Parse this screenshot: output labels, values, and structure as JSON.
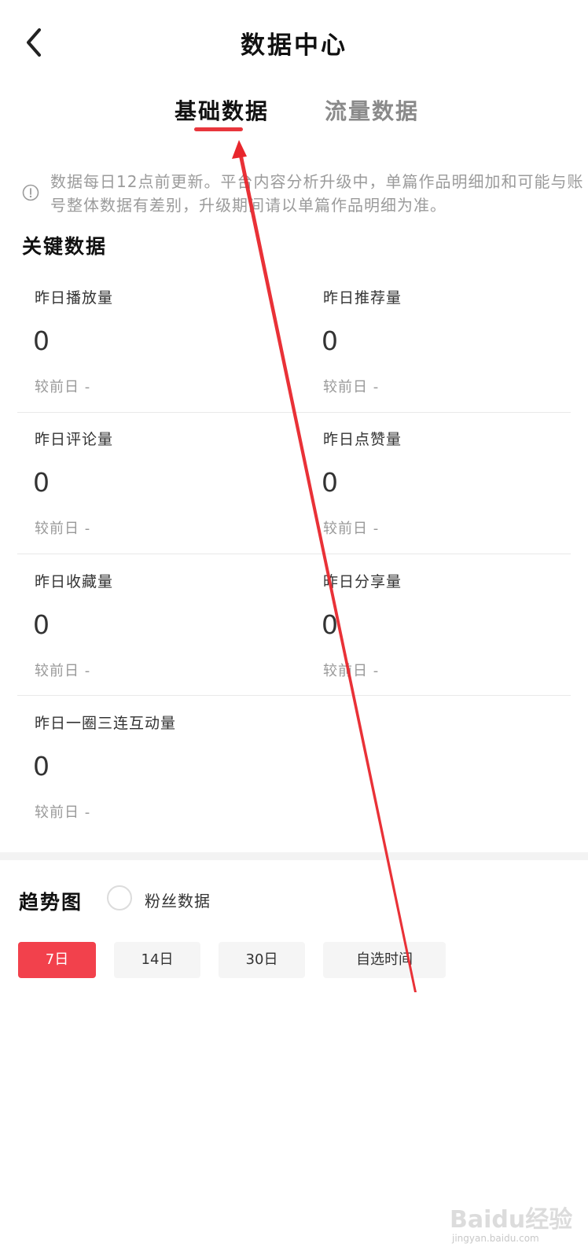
{
  "header": {
    "title": "数据中心"
  },
  "tabs": [
    {
      "label": "基础数据",
      "active": true
    },
    {
      "label": "流量数据",
      "active": false
    }
  ],
  "notice": {
    "text": "数据每日12点前更新。平台内容分析升级中，单篇作品明细加和可能与账号整体数据有差别，升级期间请以单篇作品明细为准。"
  },
  "key_data": {
    "title": "关键数据",
    "metrics": [
      {
        "label": "昨日播放量",
        "value": "0",
        "compare": "较前日  -"
      },
      {
        "label": "昨日推荐量",
        "value": "0",
        "compare": "较前日  -"
      },
      {
        "label": "昨日评论量",
        "value": "0",
        "compare": "较前日  -"
      },
      {
        "label": "昨日点赞量",
        "value": "0",
        "compare": "较前日  -"
      },
      {
        "label": "昨日收藏量",
        "value": "0",
        "compare": "较前日  -"
      },
      {
        "label": "昨日分享量",
        "value": "0",
        "compare": "较前日  -"
      },
      {
        "label": "昨日一圈三连互动量",
        "value": "0",
        "compare": "较前日  -"
      }
    ]
  },
  "trend": {
    "title": "趋势图",
    "fans_label": "粉丝数据",
    "ranges": [
      {
        "label": "7日",
        "active": true
      },
      {
        "label": "14日",
        "active": false
      },
      {
        "label": "30日",
        "active": false
      },
      {
        "label": "自选时间",
        "active": false
      }
    ]
  },
  "colors": {
    "accent": "#f2414c",
    "annotation": "#e8262c"
  },
  "watermark": {
    "brand": "Baidu经验",
    "url": "jingyan.baidu.com"
  }
}
